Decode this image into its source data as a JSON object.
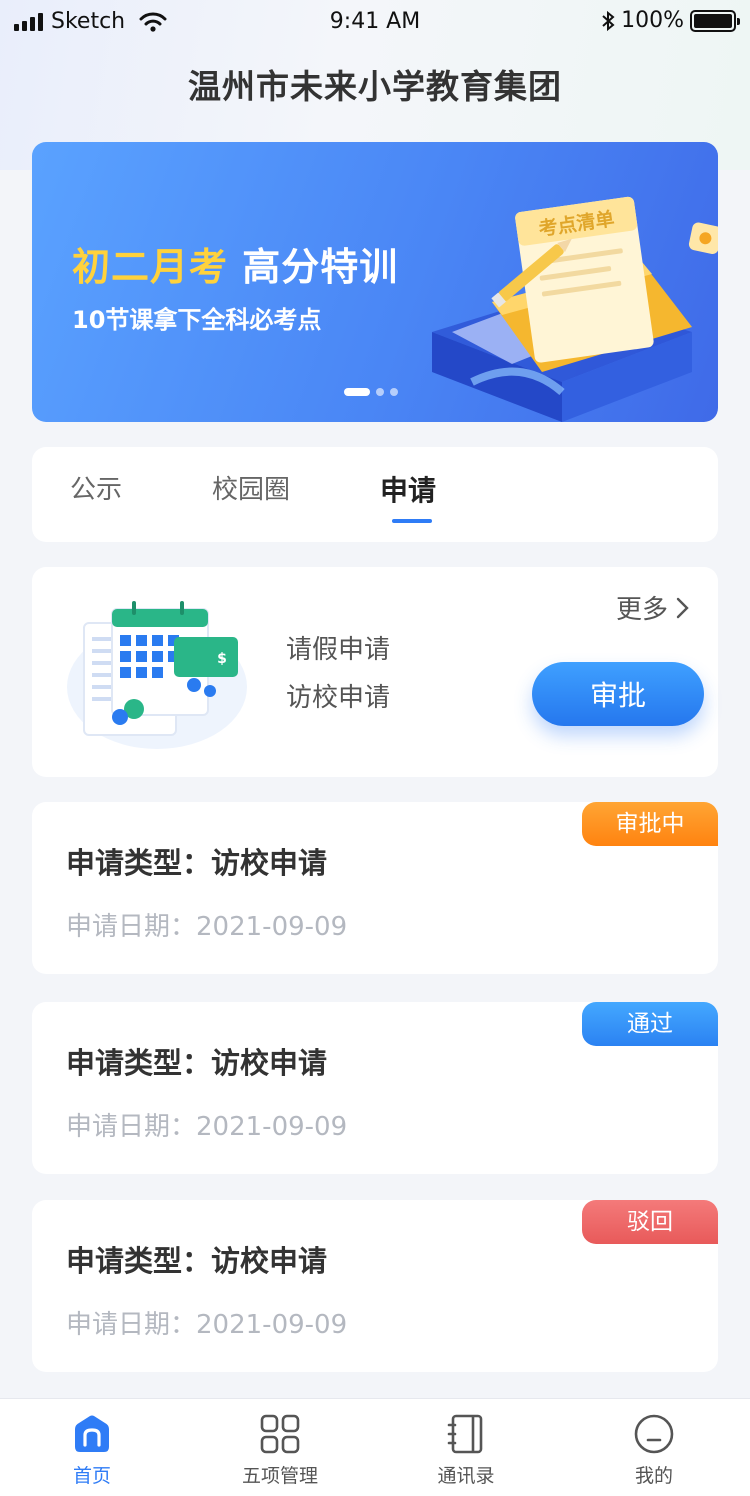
{
  "status": {
    "carrier": "Sketch",
    "time": "9:41 AM",
    "battery": "100%"
  },
  "header": {
    "title": "温州市未来小学教育集团"
  },
  "banner": {
    "highlight": "初二月考",
    "title_rest": "高分特训",
    "subtitle": "10节课拿下全科必考点",
    "illustration_text": "考点清单",
    "slide_count": 3,
    "active_slide": 1
  },
  "tabs": [
    {
      "label": "公示",
      "active": false
    },
    {
      "label": "校园圈",
      "active": false
    },
    {
      "label": "申请",
      "active": true
    }
  ],
  "apply_panel": {
    "links": [
      "请假申请",
      "访校申请"
    ],
    "more_label": "更多",
    "approve_label": "审批"
  },
  "applications": [
    {
      "type_label": "申请类型：",
      "type": "访校申请",
      "date_label": "申请日期：",
      "date": "2021-09-09",
      "status": "审批中",
      "status_color": "#ff8b1a"
    },
    {
      "type_label": "申请类型：",
      "type": "访校申请",
      "date_label": "申请日期：",
      "date": "2021-09-09",
      "status": "通过",
      "status_color": "#2b8bf7"
    },
    {
      "type_label": "申请类型：",
      "type": "访校申请",
      "date_label": "申请日期：",
      "date": "2021-09-09",
      "status": "驳回",
      "status_color": "#ef6464"
    }
  ],
  "tabbar": [
    {
      "label": "首页",
      "icon": "home-icon",
      "active": true
    },
    {
      "label": "五项管理",
      "icon": "grid-icon",
      "active": false
    },
    {
      "label": "通讯录",
      "icon": "contacts-icon",
      "active": false
    },
    {
      "label": "我的",
      "icon": "profile-icon",
      "active": false
    }
  ],
  "colors": {
    "accent": "#2f7cf6",
    "banner_highlight": "#ffd23c"
  }
}
